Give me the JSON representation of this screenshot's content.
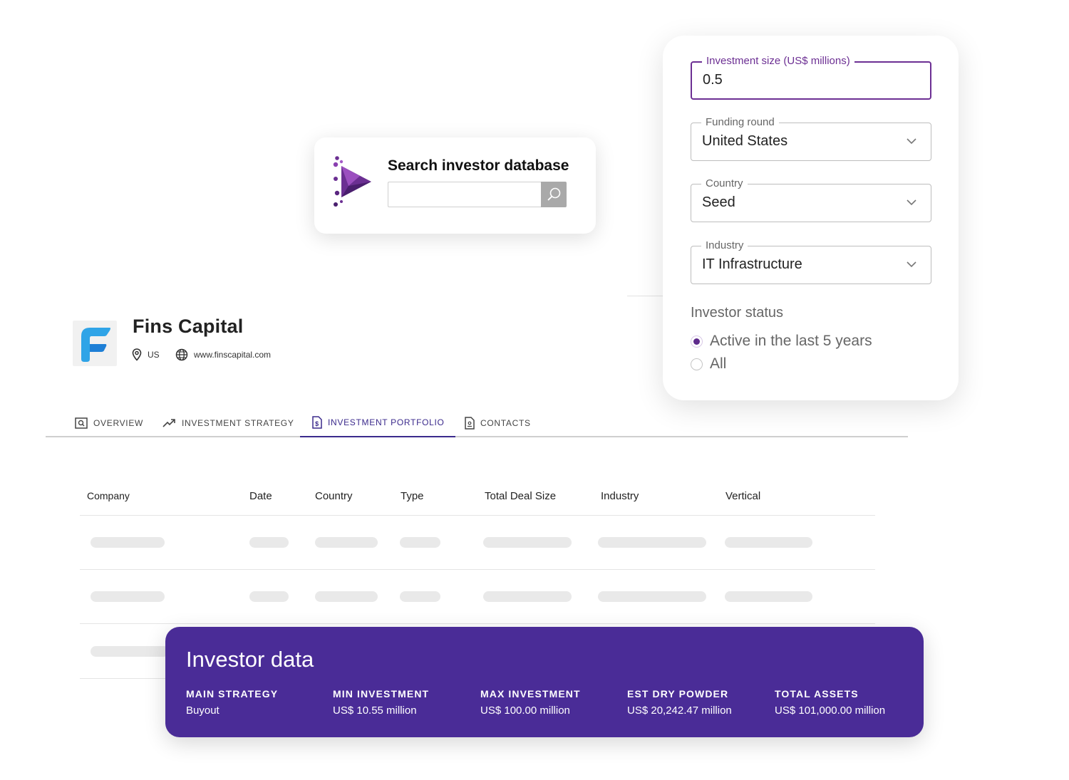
{
  "search": {
    "title": "Search investor database",
    "placeholder": "",
    "logo_icon": "brand-play-icon",
    "button_icon": "search-icon"
  },
  "filters": {
    "investment_size": {
      "label": "Investment size (US$ millions)",
      "value": "0.5"
    },
    "funding_round": {
      "label": "Funding round",
      "value": "United States"
    },
    "country": {
      "label": "Country",
      "value": "Seed"
    },
    "industry": {
      "label": "Industry",
      "value": "IT Infrastructure"
    },
    "investor_status": {
      "label": "Investor status",
      "options": [
        {
          "label": "Active in the last 5 years",
          "selected": true
        },
        {
          "label": "All",
          "selected": false
        }
      ]
    },
    "accent_color": "#6c2f93"
  },
  "company": {
    "name": "Fins Capital",
    "location": "US",
    "website": "www.finscapital.com",
    "logo_colors": [
      "#2fa4e7",
      "#1e7fd6"
    ]
  },
  "tabs": [
    {
      "label": "OVERVIEW",
      "icon": "overview-search-icon",
      "active": false
    },
    {
      "label": "INVESTMENT STRATEGY",
      "icon": "trend-up-icon",
      "active": false
    },
    {
      "label": "INVESTMENT PORTFOLIO",
      "icon": "document-dollar-icon",
      "active": true
    },
    {
      "label": "CONTACTS",
      "icon": "contact-document-icon",
      "active": false
    }
  ],
  "table": {
    "headers": [
      "Company",
      "Date",
      "Country",
      "Type",
      "Total Deal Size",
      "Industry",
      "Vertical"
    ]
  },
  "investor_data": {
    "title": "Investor data",
    "background": "#4a2c97",
    "items": [
      {
        "label": "MAIN STRATEGY",
        "value": "Buyout"
      },
      {
        "label": "MIN INVESTMENT",
        "value": "US$ 10.55 million"
      },
      {
        "label": "MAX INVESTMENT",
        "value": "US$ 100.00 million"
      },
      {
        "label": "EST DRY POWDER",
        "value": "US$ 20,242.47 million"
      },
      {
        "label": "TOTAL ASSETS",
        "value": "US$ 101,000.00 million"
      }
    ]
  }
}
